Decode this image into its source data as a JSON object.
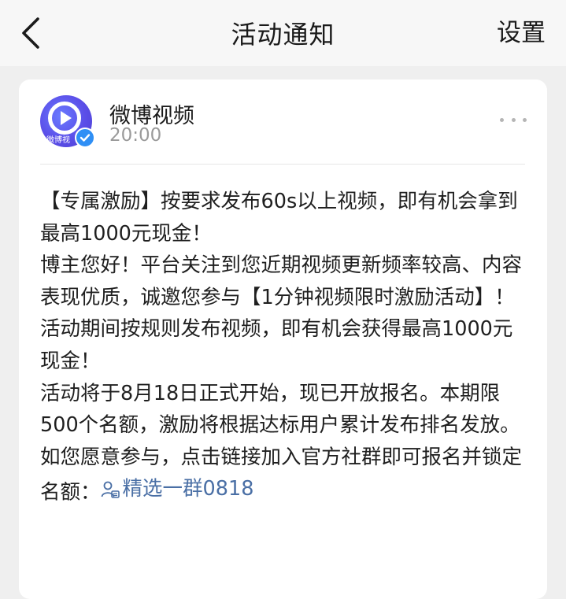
{
  "header": {
    "title": "活动通知",
    "settings_label": "设置"
  },
  "message": {
    "sender": "微博视频",
    "avatar_caption": "微博视",
    "time": "20:00",
    "lines": [
      "【专属激励】按要求发布60s以上视频，即有机会拿到最高1000元现金！",
      "博主您好！平台关注到您近期视频更新频率较高、内容表现优质，诚邀您参与【1分钟视频限时激励活动】！",
      "活动期间按规则发布视频，即有机会获得最高1000元现金！",
      "活动将于8月18日正式开始，现已开放报名。本期限500个名额，激励将根据达标用户累计发布排名发放。"
    ],
    "last_line_prefix": "如您愿意参与，点击链接加入官方社群即可报名并锁定名额：",
    "link_label": "精选一群0818"
  },
  "colors": {
    "link": "#4a6fa5",
    "verified": "#2f8ff5",
    "avatar": "#5b4ee8"
  },
  "icons": [
    "back-arrow-icon",
    "play-icon",
    "verified-check-icon",
    "more-dots-icon",
    "group-icon"
  ]
}
